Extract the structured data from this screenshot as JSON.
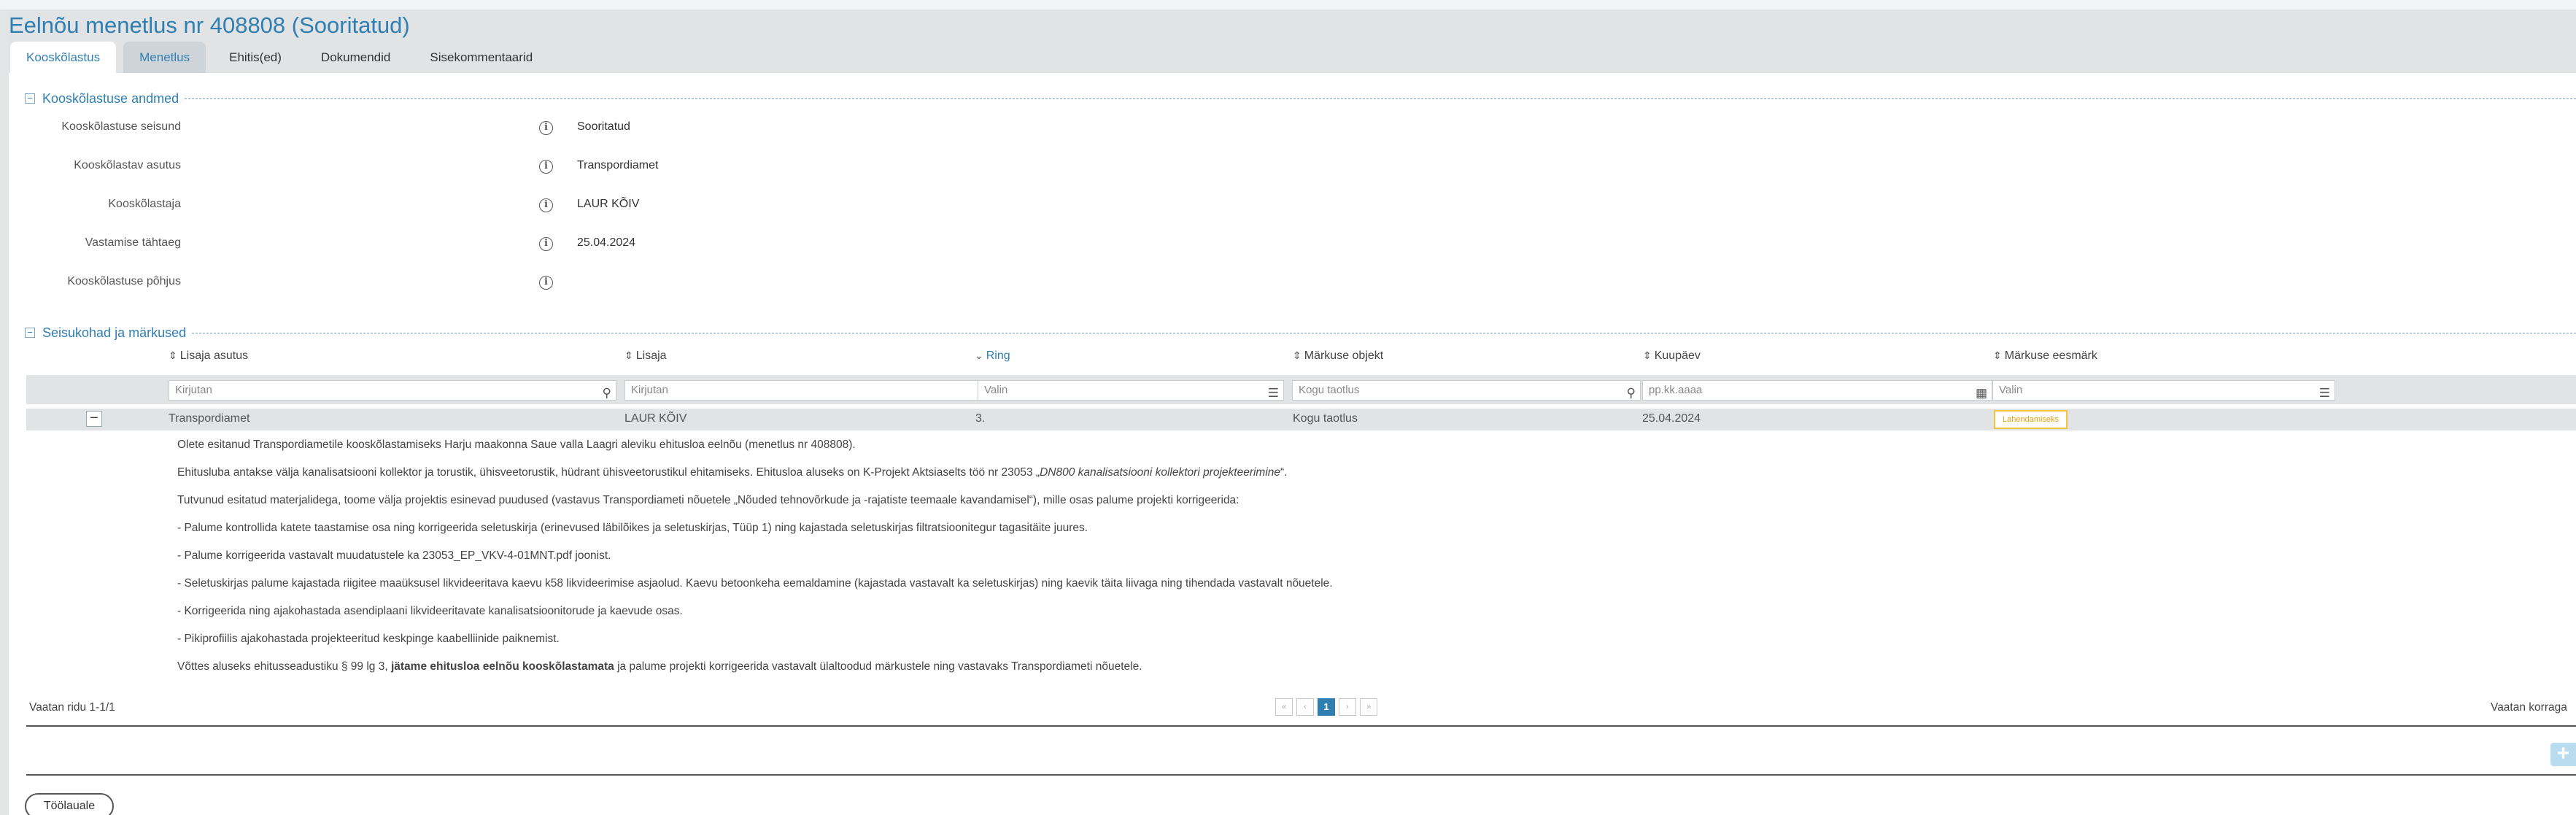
{
  "header": {
    "title": "Eelnõu menetlus nr 408808 (Sooritatud)",
    "tabs": [
      "Kooskõlastus",
      "Menetlus",
      "Ehitis(ed)",
      "Dokumendid",
      "Sisekommentaarid"
    ]
  },
  "section1": {
    "title": "Kooskõlastuse andmed",
    "fields": [
      {
        "label": "Kooskõlastuse seisund",
        "value": "Sooritatud"
      },
      {
        "label": "Kooskõlastav asutus",
        "value": "Transpordiamet"
      },
      {
        "label": "Kooskõlastaja",
        "value": "LAUR KÕIV"
      },
      {
        "label": "Vastamise tähtaeg",
        "value": "25.04.2024"
      },
      {
        "label": "Kooskõlastuse põhjus",
        "value": ""
      }
    ]
  },
  "section2": {
    "title": "Seisukohad ja märkused",
    "columns": [
      "Lisaja asutus",
      "Lisaja",
      "Ring",
      "Märkuse objekt",
      "Kuupäev",
      "Märkuse eesmärk"
    ],
    "filters": [
      {
        "placeholder": "Kirjutan",
        "icon": "search-icon"
      },
      {
        "placeholder": "Kirjutan",
        "icon": "search-icon"
      },
      {
        "placeholder": "Valin",
        "icon": "list-icon"
      },
      {
        "placeholder": "Kogu taotlus",
        "icon": "search-icon"
      },
      {
        "placeholder": "pp.kk.aaaa",
        "icon": "calendar-icon"
      },
      {
        "placeholder": "Valin",
        "icon": "list-icon"
      }
    ],
    "row": {
      "asutus": "Transpordiamet",
      "lisaja": "LAUR KÕIV",
      "ring": "3.",
      "objekt": "Kogu taotlus",
      "kuupaev": "25.04.2024",
      "eesmark": "Lahendamiseks"
    },
    "comment": {
      "p1": "Olete esitanud Transpordiametile kooskõlastamiseks Harju maakonna Saue valla Laagri aleviku ehitusloa eelnõu (menetlus nr 408808).",
      "p2_a": "Ehitusluba antakse välja kanalisatsiooni kollektor ja torustik, ühisveetorustik, hüdrant ühisveetorustikul ehitamiseks. Ehitusloa aluseks on K-Projekt Aktsiaselts töö nr 23053 „",
      "p2_em": "DN800 kanalisatsiooni kollektori projekteerimine",
      "p2_b": "“.",
      "p3": "Tutvunud esitatud materjalidega, toome välja projektis esinevad puudused (vastavus Transpordiameti nõuetele „Nõuded tehnovõrkude ja -rajatiste teemaale kavandamisel“), mille osas palume projekti korrigeerida:",
      "bullets": [
        "-  Palume kontrollida katete taastamise osa ning korrigeerida seletuskirja (erinevused läbilõikes ja seletuskirjas, Tüüp 1) ning kajastada seletuskirjas filtratsioonitegur tagasitäite juures.",
        "-  Palume korrigeerida vastavalt muudatustele ka 23053_EP_VKV-4-01MNT.pdf joonist.",
        "-  Seletuskirjas palume kajastada riigitee maaüksusel likvideeritava kaevu k58 likvideerimise asjaolud. Kaevu betoonkeha eemaldamine (kajastada vastavalt ka seletuskirjas) ning kaevik täita liivaga ning tihendada vastavalt nõuetele.",
        "-  Korrigeerida ning ajakohastada asendiplaani likvideeritavate kanalisatsioonitorude ja kaevude osas.",
        "-  Pikiprofiilis ajakohastada projekteeritud kesk­pinge kaabelliinide paiknemist."
      ],
      "last_a": "Võttes aluseks ehitusseadustiku § 99 lg 3, ",
      "last_strong": "jätame ehitusloa eelnõu kooskõlastamata",
      "last_b": " ja palume projekti korrigeerida vastavalt ülaltoodud märkustele ning vastavaks Transpordiameti nõuetele."
    },
    "footer": {
      "rows_text": "Vaatan ridu 1-1/1",
      "current_page": "1",
      "per_page_text": "Vaatan korraga"
    }
  },
  "actions": {
    "back_label": "Töölauale"
  },
  "colors": {
    "accent": "#2f7fb2",
    "header_bg": "#e1e3e5",
    "badge_border": "#f3c33a"
  }
}
